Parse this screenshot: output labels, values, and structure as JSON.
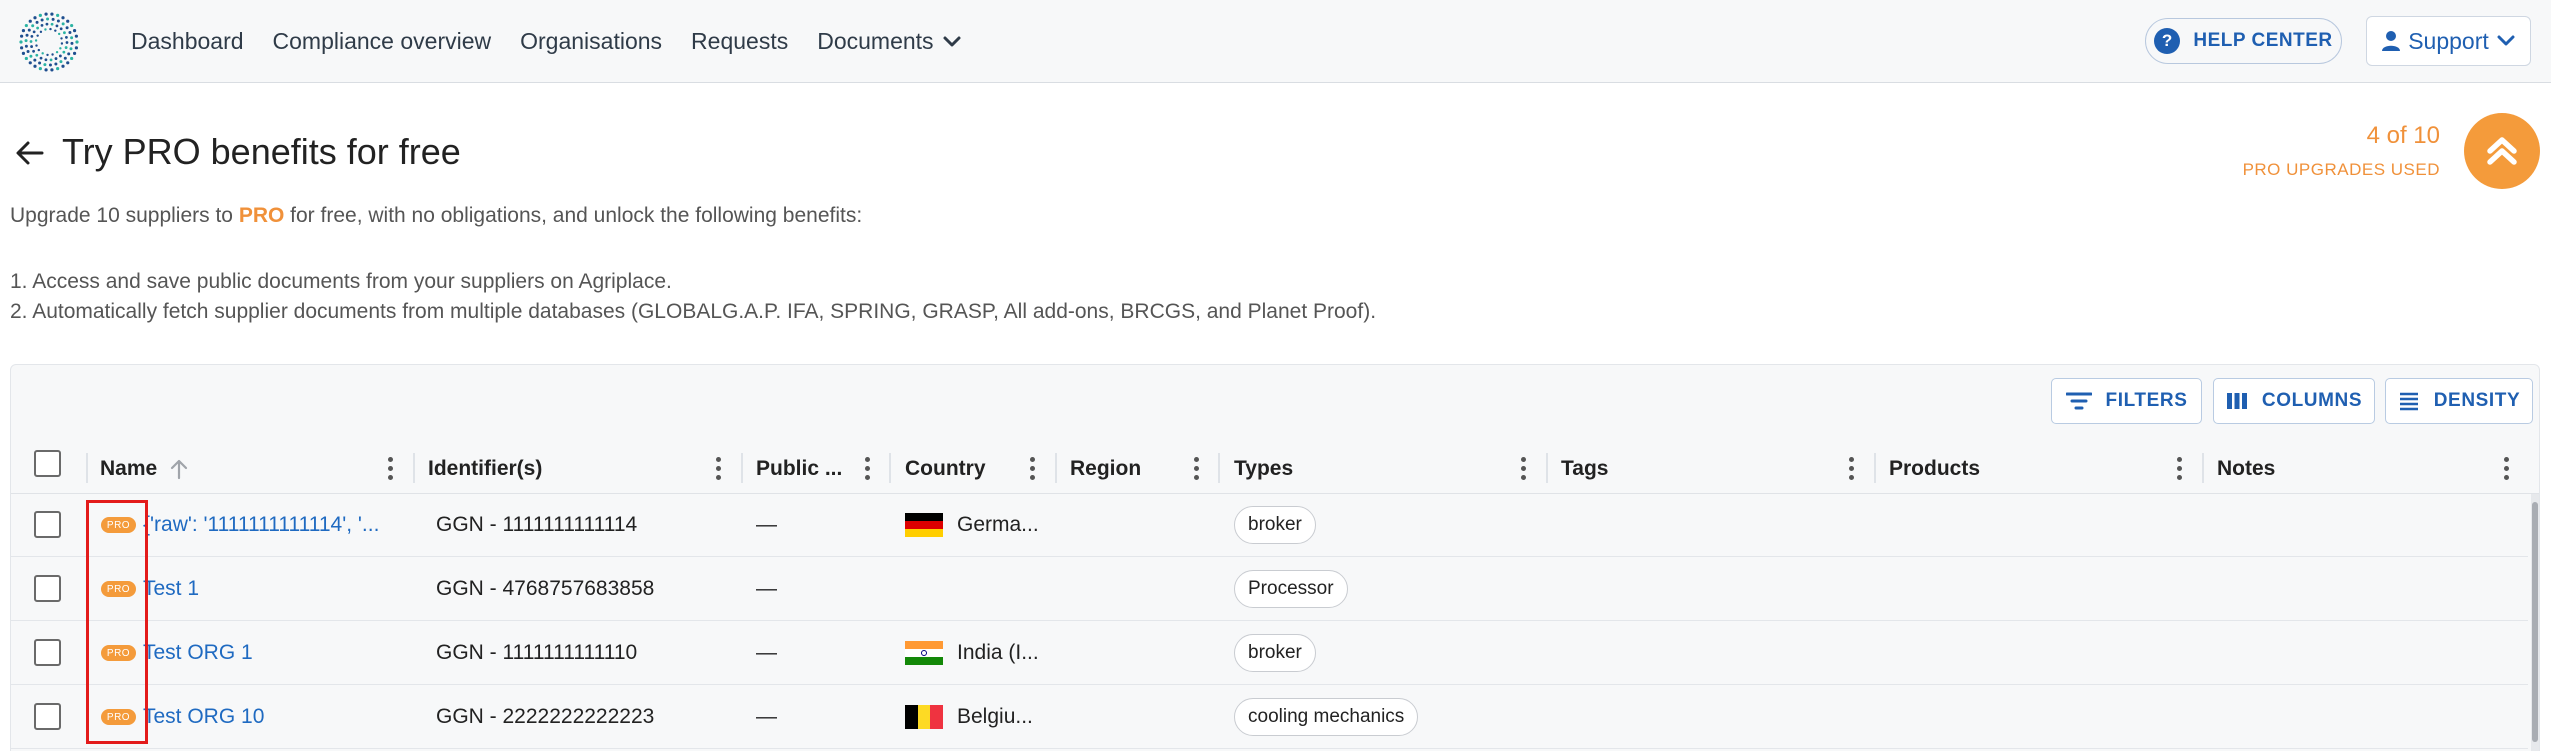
{
  "nav": {
    "items": [
      "Dashboard",
      "Compliance overview",
      "Organisations",
      "Requests",
      "Documents"
    ],
    "help_center": "HELP CENTER",
    "support": "Support"
  },
  "header": {
    "title": "Try PRO benefits for free",
    "counter": "4 of 10",
    "counter_label": "PRO UPGRADES USED",
    "intro_before": "Upgrade 10 suppliers to ",
    "intro_pro": "PRO",
    "intro_after": " for free, with no obligations, and unlock the following benefits:",
    "benefit_1": "1. Access and save public documents from your suppliers on Agriplace.",
    "benefit_2": "2. Automatically fetch supplier documents from multiple databases (GLOBALG.A.P. IFA, SPRING, GRASP, All add-ons, BRCGS, and Planet Proof)."
  },
  "toolbar": {
    "filters": "FILTERS",
    "columns": "COLUMNS",
    "density": "DENSITY"
  },
  "columns": {
    "name": "Name",
    "identifiers": "Identifier(s)",
    "public": "Public ...",
    "country": "Country",
    "region": "Region",
    "types": "Types",
    "tags": "Tags",
    "products": "Products",
    "notes": "Notes"
  },
  "rows": [
    {
      "badge": "PRO",
      "name": "{'raw': '1111111111114', '...",
      "identifier": "GGN - 1111111111114",
      "public": "—",
      "flag": "germany-flag",
      "country": "Germa...",
      "type": "broker"
    },
    {
      "badge": "PRO",
      "name": "Test 1",
      "identifier": "GGN - 4768757683858",
      "public": "—",
      "flag": "",
      "country": "",
      "type": "Processor"
    },
    {
      "badge": "PRO",
      "name": "Test ORG 1",
      "identifier": "GGN - 1111111111110",
      "public": "—",
      "flag": "india-flag",
      "country": "India (I...",
      "type": "broker"
    },
    {
      "badge": "PRO",
      "name": "Test ORG 10",
      "identifier": "GGN - 2222222222223",
      "public": "—",
      "flag": "belgium-flag",
      "country": "Belgiu...",
      "type": "cooling mechanics"
    }
  ],
  "colors": {
    "accent": "#1f5fb1",
    "pro_orange": "#f49b3b",
    "highlight": "#e31b1b"
  }
}
